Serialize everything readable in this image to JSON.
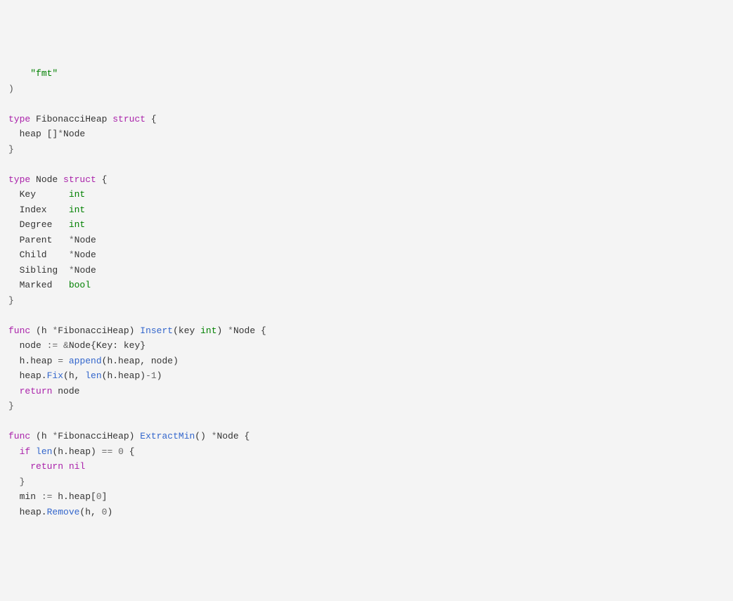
{
  "code": {
    "lines": [
      {
        "indent": "    ",
        "tokens": [
          {
            "cls": "str",
            "t": "\"fmt\""
          }
        ]
      },
      {
        "indent": "",
        "tokens": [
          {
            "cls": "punc",
            "t": ")"
          }
        ]
      },
      {
        "indent": "",
        "tokens": []
      },
      {
        "indent": "",
        "tokens": [
          {
            "cls": "kw",
            "t": "type"
          },
          {
            "cls": "",
            "t": " FibonacciHeap "
          },
          {
            "cls": "kw",
            "t": "struct"
          },
          {
            "cls": "",
            "t": " {"
          }
        ]
      },
      {
        "indent": "  ",
        "tokens": [
          {
            "cls": "",
            "t": "heap []"
          },
          {
            "cls": "op",
            "t": "*"
          },
          {
            "cls": "",
            "t": "Node"
          }
        ]
      },
      {
        "indent": "",
        "tokens": [
          {
            "cls": "punc",
            "t": "}"
          }
        ]
      },
      {
        "indent": "",
        "tokens": []
      },
      {
        "indent": "",
        "tokens": [
          {
            "cls": "kw",
            "t": "type"
          },
          {
            "cls": "",
            "t": " Node "
          },
          {
            "cls": "kw",
            "t": "struct"
          },
          {
            "cls": "",
            "t": " {"
          }
        ]
      },
      {
        "indent": "  ",
        "tokens": [
          {
            "cls": "",
            "t": "Key      "
          },
          {
            "cls": "typ",
            "t": "int"
          }
        ]
      },
      {
        "indent": "  ",
        "tokens": [
          {
            "cls": "",
            "t": "Index    "
          },
          {
            "cls": "typ",
            "t": "int"
          }
        ]
      },
      {
        "indent": "  ",
        "tokens": [
          {
            "cls": "",
            "t": "Degree   "
          },
          {
            "cls": "typ",
            "t": "int"
          }
        ]
      },
      {
        "indent": "  ",
        "tokens": [
          {
            "cls": "",
            "t": "Parent   "
          },
          {
            "cls": "op",
            "t": "*"
          },
          {
            "cls": "",
            "t": "Node"
          }
        ]
      },
      {
        "indent": "  ",
        "tokens": [
          {
            "cls": "",
            "t": "Child    "
          },
          {
            "cls": "op",
            "t": "*"
          },
          {
            "cls": "",
            "t": "Node"
          }
        ]
      },
      {
        "indent": "  ",
        "tokens": [
          {
            "cls": "",
            "t": "Sibling  "
          },
          {
            "cls": "op",
            "t": "*"
          },
          {
            "cls": "",
            "t": "Node"
          }
        ]
      },
      {
        "indent": "  ",
        "tokens": [
          {
            "cls": "",
            "t": "Marked   "
          },
          {
            "cls": "typ",
            "t": "bool"
          }
        ]
      },
      {
        "indent": "",
        "tokens": [
          {
            "cls": "punc",
            "t": "}"
          }
        ]
      },
      {
        "indent": "",
        "tokens": []
      },
      {
        "indent": "",
        "tokens": [
          {
            "cls": "kw",
            "t": "func"
          },
          {
            "cls": "",
            "t": " (h "
          },
          {
            "cls": "op",
            "t": "*"
          },
          {
            "cls": "",
            "t": "FibonacciHeap) "
          },
          {
            "cls": "fn",
            "t": "Insert"
          },
          {
            "cls": "",
            "t": "(key "
          },
          {
            "cls": "typ",
            "t": "int"
          },
          {
            "cls": "",
            "t": ") "
          },
          {
            "cls": "op",
            "t": "*"
          },
          {
            "cls": "",
            "t": "Node {"
          }
        ]
      },
      {
        "indent": "  ",
        "tokens": [
          {
            "cls": "",
            "t": "node "
          },
          {
            "cls": "op",
            "t": ":="
          },
          {
            "cls": "",
            "t": " "
          },
          {
            "cls": "op",
            "t": "&"
          },
          {
            "cls": "",
            "t": "Node{Key: key}"
          }
        ]
      },
      {
        "indent": "  ",
        "tokens": [
          {
            "cls": "",
            "t": "h.heap "
          },
          {
            "cls": "op",
            "t": "="
          },
          {
            "cls": "",
            "t": " "
          },
          {
            "cls": "fn",
            "t": "append"
          },
          {
            "cls": "",
            "t": "(h.heap, node)"
          }
        ]
      },
      {
        "indent": "  ",
        "tokens": [
          {
            "cls": "",
            "t": "heap."
          },
          {
            "cls": "fn",
            "t": "Fix"
          },
          {
            "cls": "",
            "t": "(h, "
          },
          {
            "cls": "fn",
            "t": "len"
          },
          {
            "cls": "",
            "t": "(h.heap)"
          },
          {
            "cls": "op",
            "t": "-"
          },
          {
            "cls": "num",
            "t": "1"
          },
          {
            "cls": "",
            "t": ")"
          }
        ]
      },
      {
        "indent": "  ",
        "tokens": [
          {
            "cls": "kw",
            "t": "return"
          },
          {
            "cls": "",
            "t": " node"
          }
        ]
      },
      {
        "indent": "",
        "tokens": [
          {
            "cls": "punc",
            "t": "}"
          }
        ]
      },
      {
        "indent": "",
        "tokens": []
      },
      {
        "indent": "",
        "tokens": [
          {
            "cls": "kw",
            "t": "func"
          },
          {
            "cls": "",
            "t": " (h "
          },
          {
            "cls": "op",
            "t": "*"
          },
          {
            "cls": "",
            "t": "FibonacciHeap) "
          },
          {
            "cls": "fn",
            "t": "ExtractMin"
          },
          {
            "cls": "",
            "t": "() "
          },
          {
            "cls": "op",
            "t": "*"
          },
          {
            "cls": "",
            "t": "Node {"
          }
        ]
      },
      {
        "indent": "  ",
        "tokens": [
          {
            "cls": "kw",
            "t": "if"
          },
          {
            "cls": "",
            "t": " "
          },
          {
            "cls": "fn",
            "t": "len"
          },
          {
            "cls": "",
            "t": "(h.heap) "
          },
          {
            "cls": "op",
            "t": "=="
          },
          {
            "cls": "",
            "t": " "
          },
          {
            "cls": "num",
            "t": "0"
          },
          {
            "cls": "",
            "t": " {"
          }
        ]
      },
      {
        "indent": "    ",
        "tokens": [
          {
            "cls": "kw",
            "t": "return"
          },
          {
            "cls": "",
            "t": " "
          },
          {
            "cls": "nil",
            "t": "nil"
          }
        ]
      },
      {
        "indent": "  ",
        "tokens": [
          {
            "cls": "punc",
            "t": "}"
          }
        ]
      },
      {
        "indent": "  ",
        "tokens": [
          {
            "cls": "",
            "t": "min "
          },
          {
            "cls": "op",
            "t": ":="
          },
          {
            "cls": "",
            "t": " h.heap["
          },
          {
            "cls": "num",
            "t": "0"
          },
          {
            "cls": "",
            "t": "]"
          }
        ]
      },
      {
        "indent": "  ",
        "tokens": [
          {
            "cls": "",
            "t": "heap."
          },
          {
            "cls": "fn",
            "t": "Remove"
          },
          {
            "cls": "",
            "t": "(h, "
          },
          {
            "cls": "num",
            "t": "0"
          },
          {
            "cls": "",
            "t": ")"
          }
        ]
      }
    ]
  }
}
